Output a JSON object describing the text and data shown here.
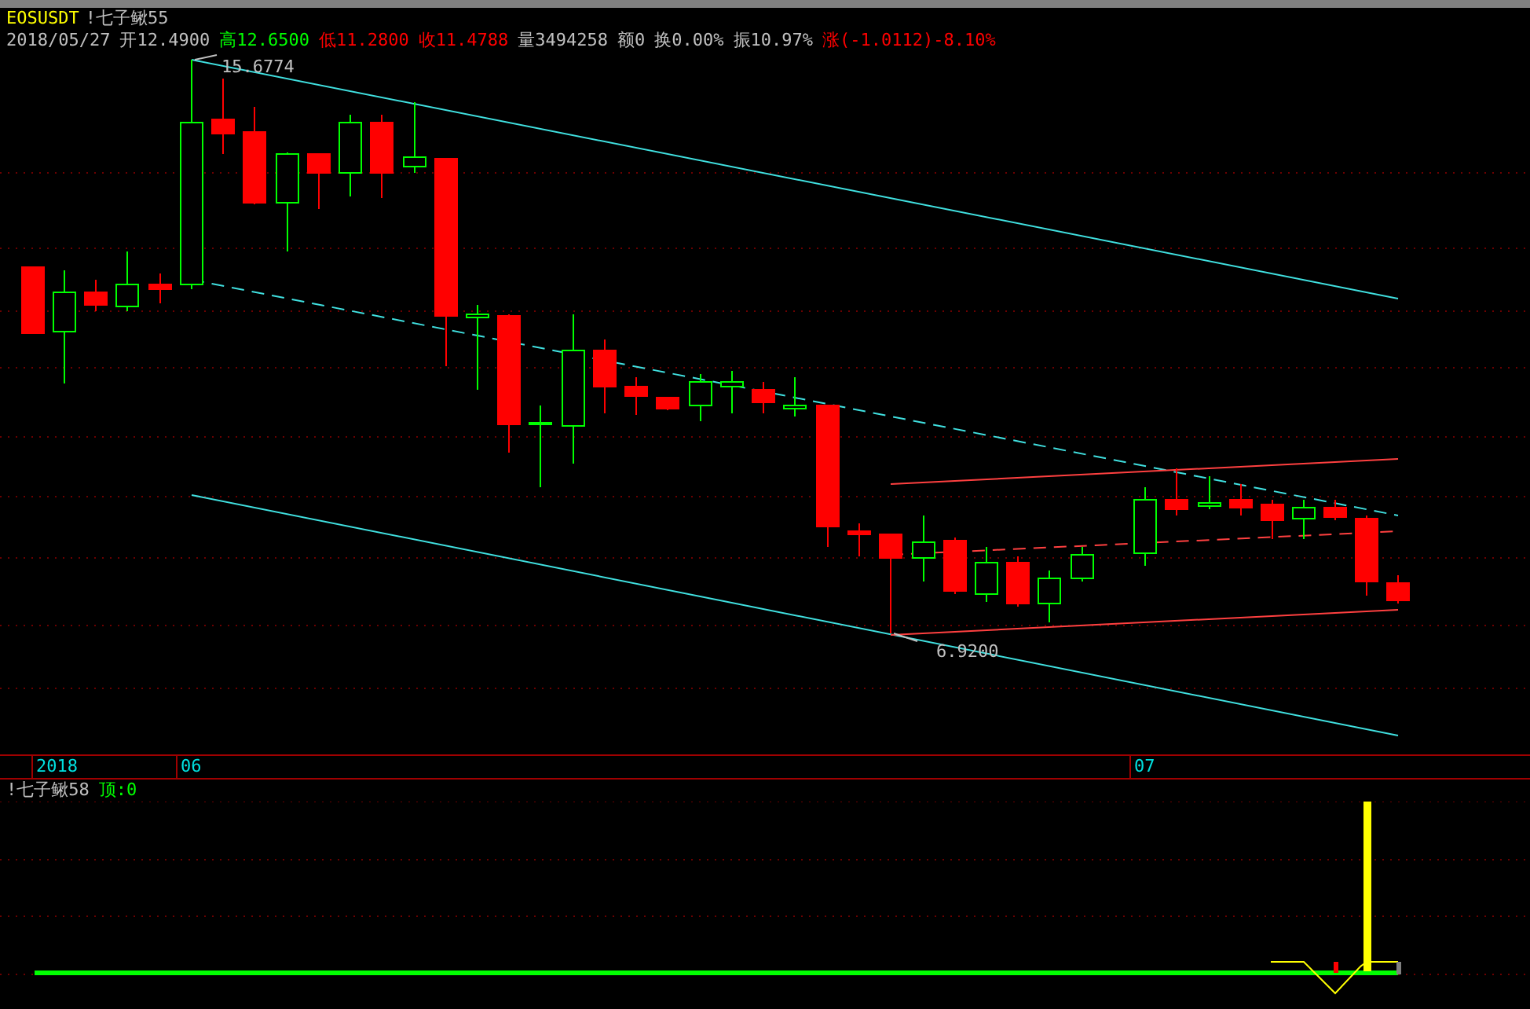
{
  "header": {
    "symbol": "EOSUSDT",
    "indicator": "!七子鳅55",
    "date": "2018/05/27",
    "quotes": [
      {
        "text": "开12.4900",
        "color": "#c0c0c0"
      },
      {
        "text": "高12.6500",
        "color": "#00ff00"
      },
      {
        "text": "低11.2800",
        "color": "#ff0000"
      },
      {
        "text": "收11.4788",
        "color": "#ff0000"
      },
      {
        "text": "量3494258",
        "color": "#c0c0c0"
      },
      {
        "text": "额0",
        "color": "#c0c0c0"
      },
      {
        "text": "换0.00%",
        "color": "#c0c0c0"
      },
      {
        "text": "振10.97%",
        "color": "#c0c0c0"
      },
      {
        "text": "涨(-1.0112)-8.10%",
        "color": "#ff0000"
      }
    ]
  },
  "price_chart": {
    "high_label": "15.6774",
    "low_label": "6.9200"
  },
  "time_axis": [
    "2018",
    "06",
    "07"
  ],
  "lower_panel": {
    "indicator": "!七子鳅58",
    "reading": "顶:0"
  }
}
